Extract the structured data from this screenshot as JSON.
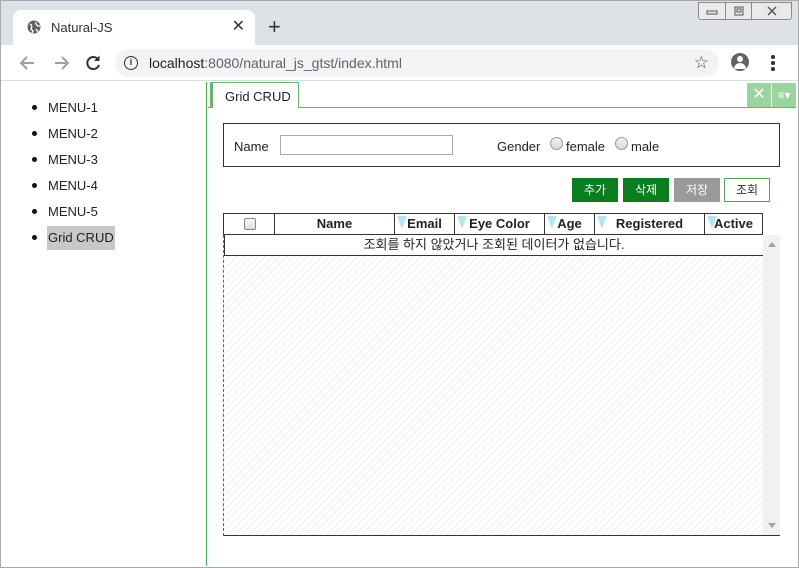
{
  "browser": {
    "tab_title": "Natural-JS",
    "tab_close": "✕",
    "new_tab": "+",
    "url_host": "localhost",
    "url_rest": ":8080/natural_js_gtst/index.html",
    "icons": [
      "globe-icon",
      "back-icon",
      "forward-icon",
      "reload-icon",
      "info-icon",
      "star-icon",
      "profile-icon",
      "menu-icon"
    ]
  },
  "sidebar": {
    "items": [
      {
        "label": "MENU-1"
      },
      {
        "label": "MENU-2"
      },
      {
        "label": "MENU-3"
      },
      {
        "label": "MENU-4"
      },
      {
        "label": "MENU-5"
      },
      {
        "label": "Grid CRUD",
        "active": true
      }
    ]
  },
  "main": {
    "tab_label": "Grid CRUD",
    "search": {
      "name_label": "Name",
      "name_value": "",
      "gender_label": "Gender",
      "options": [
        "female",
        "male"
      ]
    },
    "buttons": {
      "add": "추가",
      "delete": "삭제",
      "save": "저장",
      "search": "조회"
    },
    "grid": {
      "columns": [
        "",
        "Name",
        "Email",
        "Eye Color",
        "Age",
        "Registered",
        "Active"
      ],
      "empty_message": "조회를 하지 않았거나 조회된 데이터가 없습니다."
    }
  },
  "colors": {
    "accent": "#6ab56b",
    "button_green": "#0a7d1e",
    "button_gray": "#9a9a9a"
  }
}
